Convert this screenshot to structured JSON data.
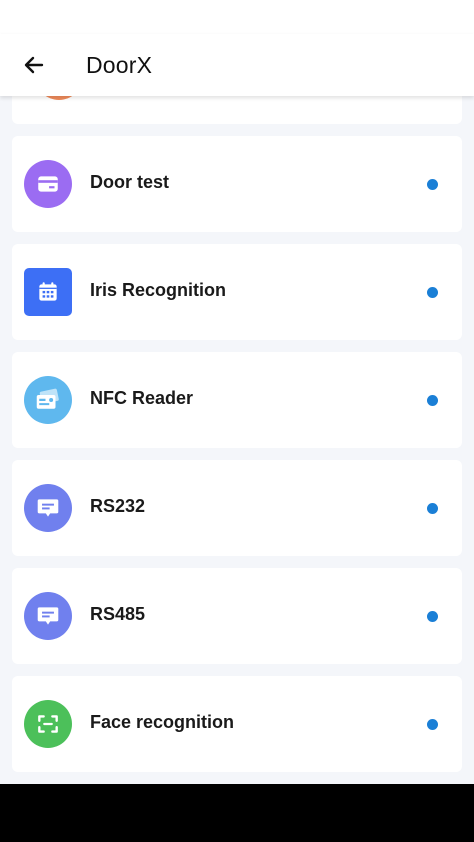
{
  "app": {
    "title": "DoorX"
  },
  "items": [
    {
      "label": "Door test",
      "icon": "card-icon",
      "color": "#9b6cf2"
    },
    {
      "label": "Iris Recognition",
      "icon": "calendar-icon",
      "color": "#3d6ff5"
    },
    {
      "label": "NFC Reader",
      "icon": "id-card-icon",
      "color": "#5fb8ee"
    },
    {
      "label": "RS232",
      "icon": "chat-icon",
      "color": "#7080ee"
    },
    {
      "label": "RS485",
      "icon": "chat-icon",
      "color": "#7080ee"
    },
    {
      "label": "Face recognition",
      "icon": "face-scan-icon",
      "color": "#4cc05a"
    }
  ],
  "colors": {
    "status_dot": "#1a7fd6",
    "partial_item_icon": "#ef8b5a"
  }
}
